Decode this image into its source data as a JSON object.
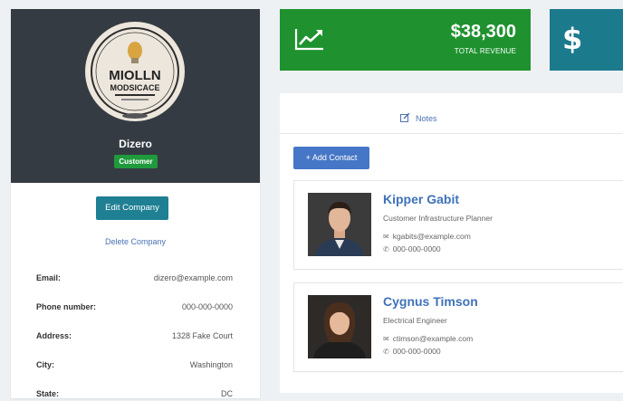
{
  "company": {
    "logo_text_line1": "MIOLLN",
    "logo_text_line2": "MODSICACE",
    "name": "Dizero",
    "badge": "Customer",
    "edit_label": "Edit Company",
    "delete_label": "Delete Company",
    "info": [
      {
        "label": "Email:",
        "value": "dizero@example.com"
      },
      {
        "label": "Phone number:",
        "value": "000-000-0000"
      },
      {
        "label": "Address:",
        "value": "1328 Fake Court"
      },
      {
        "label": "City:",
        "value": "Washington"
      },
      {
        "label": "State:",
        "value": "DC"
      }
    ]
  },
  "stats": {
    "revenue_value": "$38,300",
    "revenue_label": "TOTAL REVENUE",
    "second_icon": "$"
  },
  "main": {
    "notes_tab": "Notes",
    "add_contact_label": "+ Add Contact",
    "contacts": [
      {
        "name": "Kipper Gabit",
        "title": "Customer Infrastructure Planner",
        "email": "kgabits@example.com",
        "phone": "000-000-0000"
      },
      {
        "name": "Cygnus Timson",
        "title": "Electrical Engineer",
        "email": "ctimson@example.com",
        "phone": "000-000-0000"
      }
    ]
  },
  "colors": {
    "revenue_green": "#1f922f",
    "teal": "#1c7a8d",
    "header_dark": "#353b42",
    "link_blue": "#3f72b8"
  }
}
